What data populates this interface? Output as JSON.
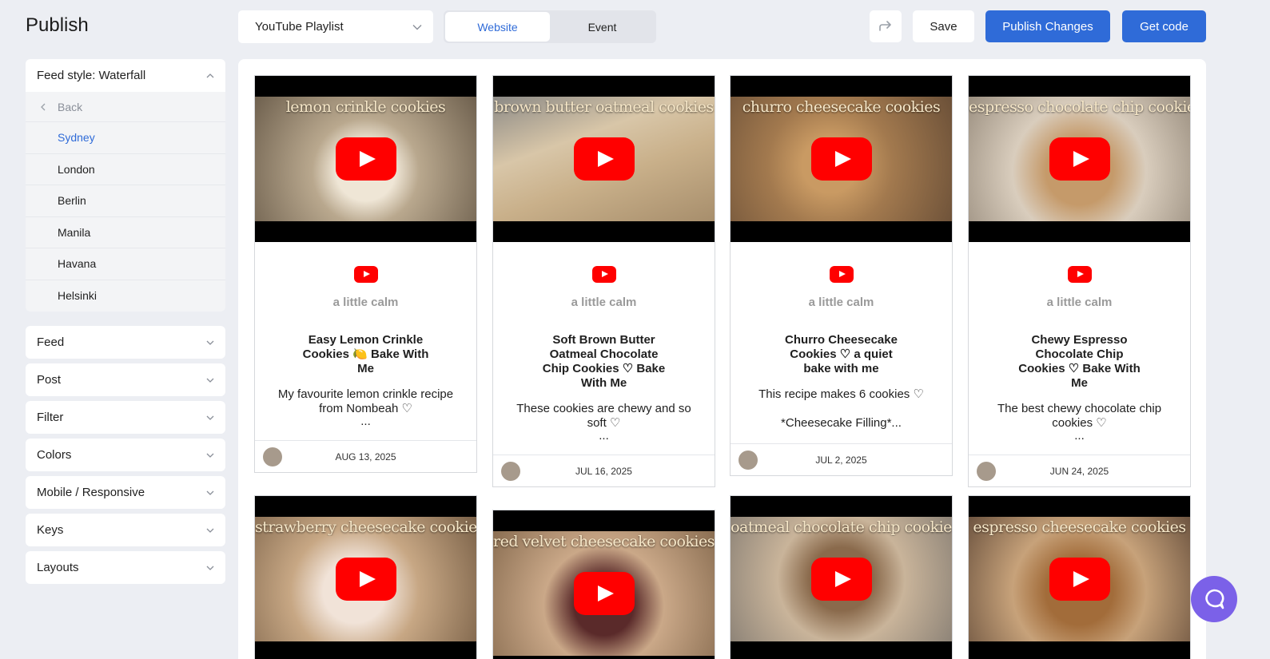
{
  "page": {
    "title": "Publish"
  },
  "toolbar": {
    "source_select": "YouTube Playlist",
    "tabs": [
      {
        "label": "Website",
        "active": true
      },
      {
        "label": "Event",
        "active": false
      }
    ],
    "save_label": "Save",
    "publish_label": "Publish Changes",
    "get_code_label": "Get code"
  },
  "sidebar": {
    "feed_style": {
      "label": "Feed style: Waterfall",
      "back_label": "Back",
      "options": [
        "Sydney",
        "London",
        "Berlin",
        "Manila",
        "Havana",
        "Helsinki"
      ],
      "selected": "Sydney"
    },
    "panels": [
      "Feed",
      "Post",
      "Filter",
      "Colors",
      "Mobile / Responsive",
      "Keys",
      "Layouts"
    ]
  },
  "cards": [
    {
      "caption": "lemon crinkle cookies",
      "channel": "a little calm",
      "title": "Easy Lemon Crinkle Cookies 🍋 Bake With Me",
      "desc": "My favourite lemon crinkle recipe from Nombeah ♡",
      "ellipsis": "...",
      "date": "AUG 13, 2025"
    },
    {
      "caption": "brown butter oatmeal cookies",
      "channel": "a little calm",
      "title": "Soft Brown Butter Oatmeal Chocolate Chip Cookies ♡ Bake With Me",
      "desc": "These cookies are chewy and so soft ♡",
      "ellipsis": "...",
      "date": "JUL 16, 2025"
    },
    {
      "caption": "churro cheesecake cookies",
      "channel": "a little calm",
      "title": "Churro Cheesecake Cookies ♡ a quiet bake with me",
      "desc": "This recipe makes 6 cookies ♡\n\n*Cheesecake Filling*...",
      "ellipsis": "",
      "date": "JUL 2, 2025"
    },
    {
      "caption": "espresso chocolate chip cookies",
      "channel": "a little calm",
      "title": "Chewy Espresso Chocolate Chip Cookies ♡ Bake With Me",
      "desc": "The best chewy chocolate chip cookies ♡",
      "ellipsis": "...",
      "date": "JUN 24, 2025"
    },
    {
      "caption": "strawberry cheesecake cookies"
    },
    {
      "caption": "red velvet cheesecake cookies"
    },
    {
      "caption": "oatmeal chocolate chip cookie"
    },
    {
      "caption": "espresso cheesecake cookies"
    }
  ],
  "colors": {
    "accent": "#2f6bd8",
    "youtube_red": "#ff0000",
    "help_bubble": "#7b61e8"
  }
}
